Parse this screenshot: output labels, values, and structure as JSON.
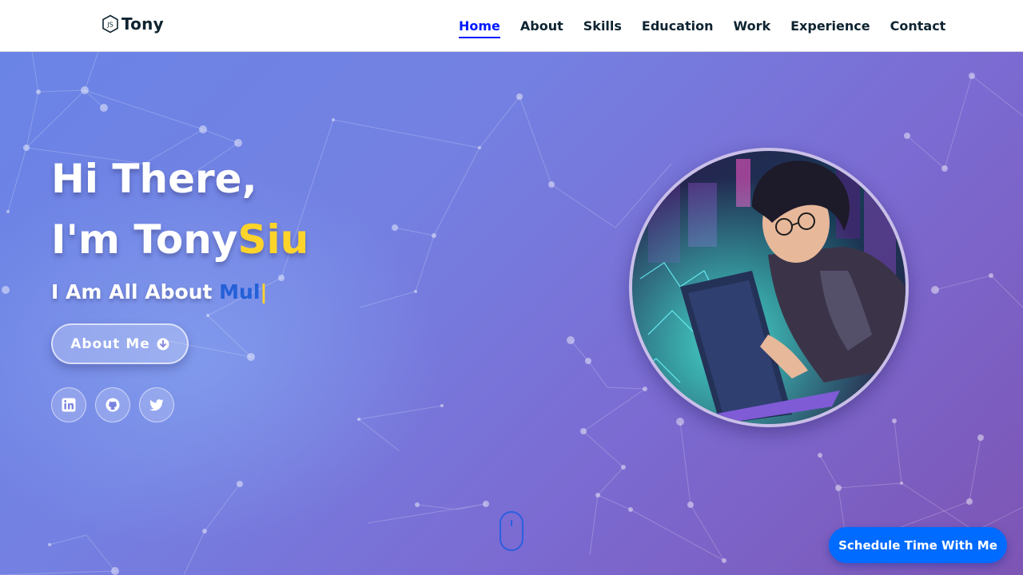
{
  "header": {
    "logo_text": "Tony",
    "logo_icon": "nodejs-hexagon-icon",
    "nav": [
      {
        "label": "Home",
        "active": true
      },
      {
        "label": "About",
        "active": false
      },
      {
        "label": "Skills",
        "active": false
      },
      {
        "label": "Education",
        "active": false
      },
      {
        "label": "Work",
        "active": false
      },
      {
        "label": "Experience",
        "active": false
      },
      {
        "label": "Contact",
        "active": false
      }
    ],
    "active_color": "#011aff"
  },
  "hero": {
    "greeting": "Hi There,",
    "name_prefix": "I'm Tony",
    "name_highlight": "Siu",
    "tagline_prefix": "I Am All About ",
    "tagline_typed": "Mul",
    "tagline_caret": "|",
    "about_button": {
      "label": "About Me",
      "icon": "arrow-circle-down-icon"
    },
    "socials": [
      {
        "name": "linkedin",
        "icon": "linkedin-icon"
      },
      {
        "name": "github",
        "icon": "github-icon"
      },
      {
        "name": "twitter",
        "icon": "twitter-icon"
      }
    ],
    "highlight_color": "#ffd42a",
    "scroll_indicator": "mouse-scroll-icon"
  },
  "schedule_button": {
    "label": "Schedule Time With Me",
    "color": "#006bff"
  }
}
